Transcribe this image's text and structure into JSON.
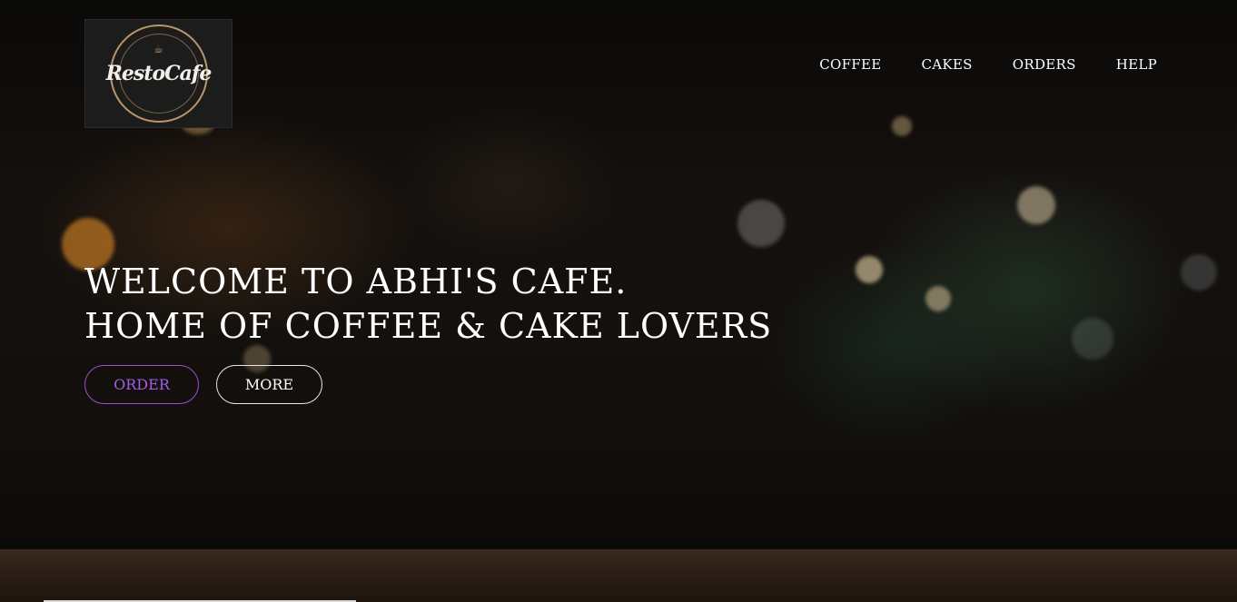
{
  "logo": {
    "text": "RestoCafe",
    "icon": "coffee-cup-icon"
  },
  "nav": {
    "items": [
      {
        "label": "COFFEE"
      },
      {
        "label": "CAKES"
      },
      {
        "label": "ORDERS"
      },
      {
        "label": "HELP"
      }
    ]
  },
  "hero": {
    "line1": "WELCOME TO ABHI'S CAFE.",
    "line2": "HOME OF COFFEE & CAKE LOVERS"
  },
  "buttons": {
    "order_label": "ORDER",
    "more_label": "MORE"
  },
  "colors": {
    "accent": "#a45ce6",
    "text": "#ffffff",
    "logo_ring": "#b8956a"
  }
}
